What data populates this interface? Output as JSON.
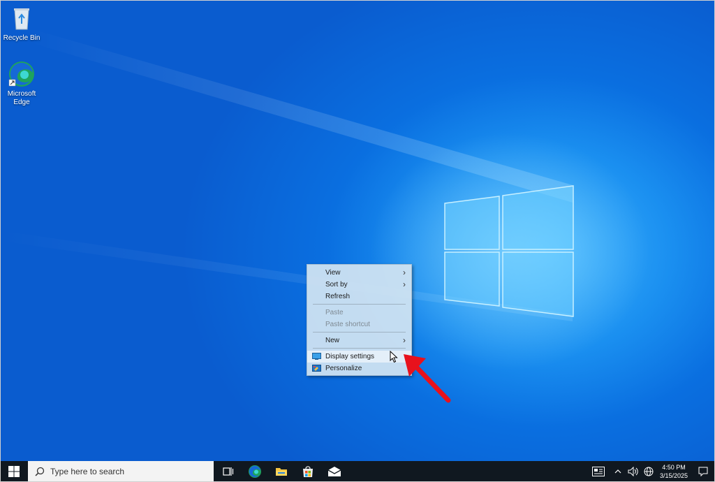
{
  "desktop": {
    "icons": [
      {
        "label": "Recycle Bin",
        "icon": "recycle-bin-icon"
      },
      {
        "label": "Microsoft Edge",
        "icon": "edge-icon"
      }
    ]
  },
  "context_menu": {
    "items": [
      {
        "label": "View",
        "submenu": true,
        "enabled": true
      },
      {
        "label": "Sort by",
        "submenu": true,
        "enabled": true
      },
      {
        "label": "Refresh",
        "submenu": false,
        "enabled": true
      },
      {
        "label": "Paste",
        "submenu": false,
        "enabled": false
      },
      {
        "label": "Paste shortcut",
        "submenu": false,
        "enabled": false
      },
      {
        "label": "New",
        "submenu": true,
        "enabled": true
      },
      {
        "label": "Display settings",
        "submenu": false,
        "enabled": true,
        "icon": "display-icon"
      },
      {
        "label": "Personalize",
        "submenu": false,
        "enabled": true,
        "icon": "personalize-icon"
      }
    ],
    "highlighted": "Display settings"
  },
  "taskbar": {
    "search_placeholder": "Type here to search",
    "apps": [
      "task-view-icon",
      "edge-icon",
      "file-explorer-icon",
      "store-icon",
      "mail-icon"
    ],
    "clock_time": "4:50 PM",
    "clock_date": "3/15/2025"
  },
  "colors": {
    "accent": "#0a6fe0",
    "annotation_arrow": "#e8121c",
    "taskbar_bg": "#101820"
  }
}
